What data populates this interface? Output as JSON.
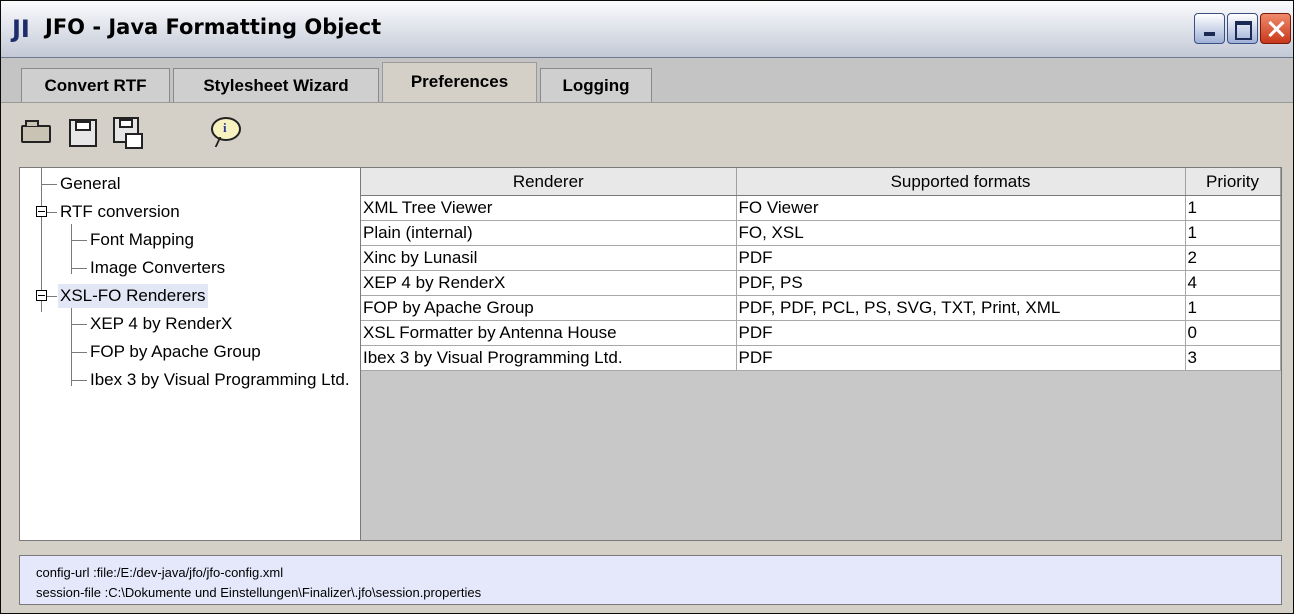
{
  "window": {
    "icon": "JI",
    "title": "JFO - Java Formatting Object",
    "controls": [
      "minimize-icon",
      "maximize-icon",
      "close-icon"
    ]
  },
  "tabs": [
    {
      "label": "Convert RTF",
      "active": false
    },
    {
      "label": "Stylesheet Wizard",
      "active": false
    },
    {
      "label": "Preferences",
      "active": true
    },
    {
      "label": "Logging",
      "active": false
    }
  ],
  "toolbar": {
    "buttons": [
      "open-folder-icon",
      "save-icon",
      "save-as-icon",
      "info-icon"
    ]
  },
  "tree": {
    "nodes": [
      {
        "label": "General",
        "level": 0,
        "expandable": false,
        "selected": false
      },
      {
        "label": "RTF conversion",
        "level": 0,
        "expandable": true,
        "selected": false
      },
      {
        "label": "Font Mapping",
        "level": 1,
        "expandable": false,
        "selected": false
      },
      {
        "label": "Image Converters",
        "level": 1,
        "expandable": false,
        "selected": false
      },
      {
        "label": "XSL-FO Renderers",
        "level": 0,
        "expandable": true,
        "selected": true
      },
      {
        "label": "XEP 4 by RenderX",
        "level": 1,
        "expandable": false,
        "selected": false
      },
      {
        "label": "FOP by Apache Group",
        "level": 1,
        "expandable": false,
        "selected": false
      },
      {
        "label": "Ibex 3 by Visual Programming Ltd.",
        "level": 1,
        "expandable": false,
        "selected": false
      }
    ]
  },
  "table": {
    "columns": [
      "Renderer",
      "Supported formats",
      "Priority"
    ],
    "rows": [
      [
        "XML Tree Viewer",
        "FO Viewer",
        "1"
      ],
      [
        "Plain (internal)",
        "FO, XSL",
        "1"
      ],
      [
        "Xinc by Lunasil",
        "PDF",
        "2"
      ],
      [
        "XEP 4 by RenderX",
        "PDF, PS",
        "4"
      ],
      [
        "FOP by Apache Group",
        "PDF, PDF, PCL, PS, SVG, TXT, Print, XML",
        "1"
      ],
      [
        "XSL Formatter by Antenna House",
        "PDF",
        "0"
      ],
      [
        "Ibex 3 by Visual Programming Ltd.",
        "PDF",
        "3"
      ]
    ]
  },
  "status": {
    "config_url": "config-url   :file:/E:/dev-java/jfo/jfo-config.xml",
    "session_file": "session-file :C:\\Dokumente und Einstellungen\\Finalizer\\.jfo\\session.properties"
  },
  "colors": {
    "status_bg": "#e5e8fa",
    "selection_bg": "#e3e6f5",
    "close_button": "#c8381c"
  }
}
